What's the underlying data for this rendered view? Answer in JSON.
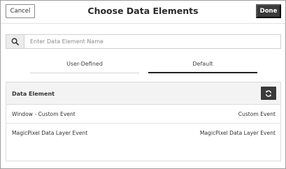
{
  "header": {
    "cancel_label": "Cancel",
    "title": "Choose Data Elements",
    "done_label": "Done"
  },
  "search": {
    "placeholder": "Enter Data Element Name",
    "value": "",
    "icon": "search-icon"
  },
  "tabs": [
    {
      "label": "User-Defined",
      "active": false
    },
    {
      "label": "Default",
      "active": true
    }
  ],
  "table": {
    "header_label": "Data Element",
    "refresh_icon": "refresh-icon",
    "rows": [
      {
        "name": "Window - Custom Event",
        "type": "Custom Event"
      },
      {
        "name": "MagicPixel Data Layer Event",
        "type": "MagicPixel Data Layer Event"
      }
    ]
  },
  "colors": {
    "primary_button": "#3a3a3a",
    "active_tab_underline": "#222222",
    "table_header_bg": "#f3f3f3"
  }
}
